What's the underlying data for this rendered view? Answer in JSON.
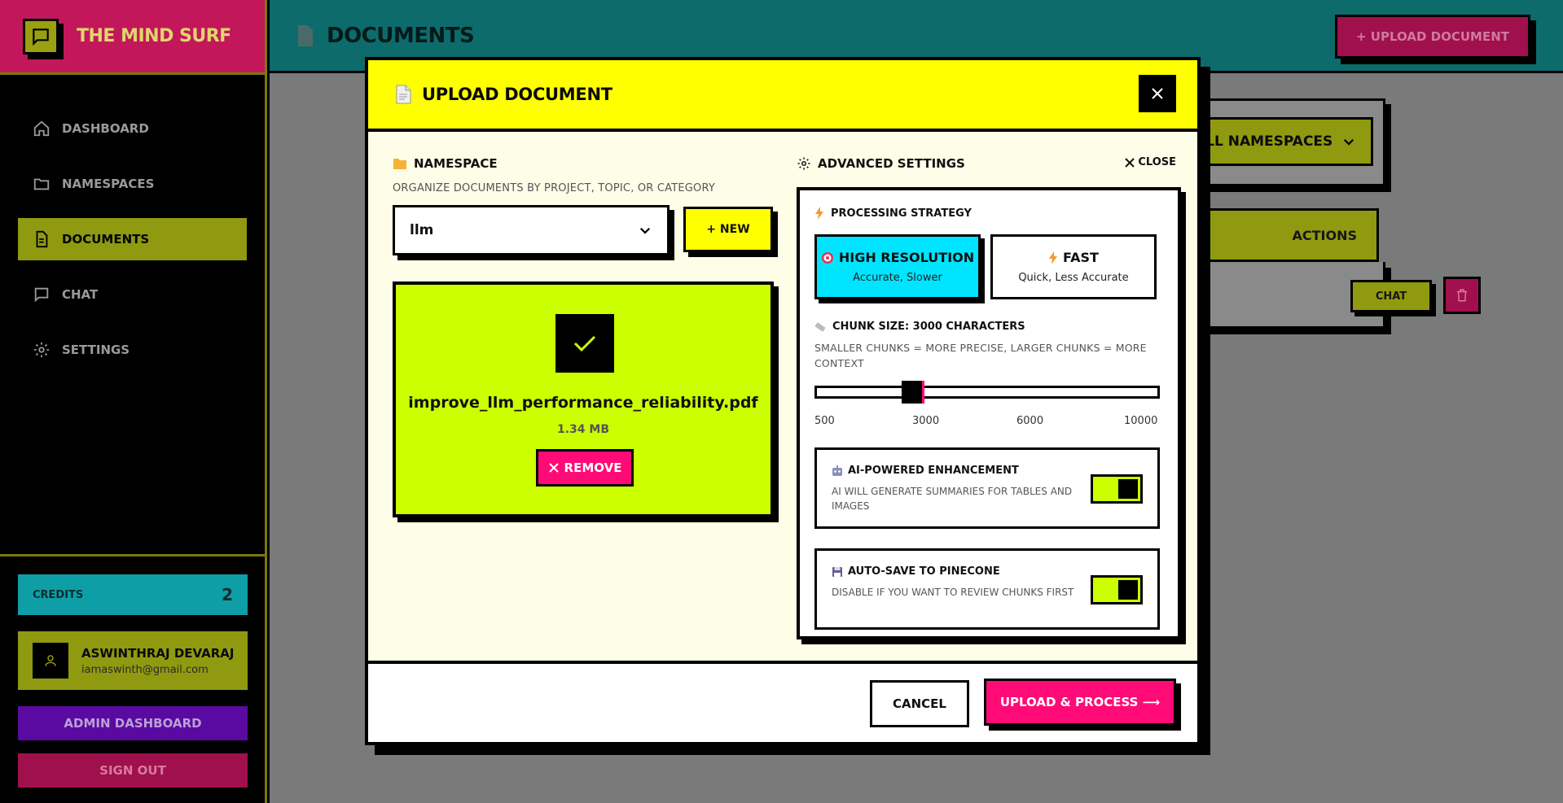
{
  "app": {
    "title": "THE MIND SURF"
  },
  "sidebar": {
    "items": [
      {
        "label": "DASHBOARD",
        "icon": "home-icon"
      },
      {
        "label": "NAMESPACES",
        "icon": "folder-icon"
      },
      {
        "label": "DOCUMENTS",
        "icon": "file-icon",
        "active": true
      },
      {
        "label": "CHAT",
        "icon": "chat-icon"
      },
      {
        "label": "SETTINGS",
        "icon": "gear-icon"
      }
    ],
    "credits": {
      "label": "CREDITS",
      "value": "2"
    },
    "user": {
      "name": "ASWINTHRAJ DEVARAJ",
      "email": "iamaswinth@gmail.com"
    },
    "admin_label": "ADMIN DASHBOARD",
    "signout_label": "SIGN OUT"
  },
  "page": {
    "title": "DOCUMENTS",
    "upload_label": "+ UPLOAD DOCUMENT",
    "namespace_filter": "ALL NAMESPACES",
    "actions_header": "ACTIONS",
    "row_chat_label": "CHAT"
  },
  "modal": {
    "title": "UPLOAD DOCUMENT",
    "namespace": {
      "title": "NAMESPACE",
      "help": "ORGANIZE DOCUMENTS BY PROJECT, TOPIC, OR CATEGORY",
      "selected": "llm",
      "new_label": "+ NEW"
    },
    "file": {
      "name": "improve_llm_performance_reliability.pdf",
      "size": "1.34 MB",
      "remove_label": "REMOVE"
    },
    "advanced": {
      "title": "ADVANCED SETTINGS",
      "close_label": "CLOSE",
      "strategy_title": "PROCESSING STRATEGY",
      "strategies": [
        {
          "title": "HIGH RESOLUTION",
          "desc": "Accurate, Slower",
          "selected": true
        },
        {
          "title": "FAST",
          "desc": "Quick, Less Accurate",
          "selected": false
        }
      ],
      "chunk": {
        "title": "CHUNK SIZE: 3000 CHARACTERS",
        "help": "SMALLER CHUNKS = MORE PRECISE, LARGER CHUNKS = MORE CONTEXT",
        "value": 3000,
        "ticks": [
          "500",
          "3000",
          "6000",
          "10000"
        ]
      },
      "toggles": [
        {
          "title": "AI-POWERED ENHANCEMENT",
          "desc": "AI WILL GENERATE SUMMARIES FOR TABLES AND IMAGES",
          "on": true
        },
        {
          "title": "AUTO-SAVE TO PINECONE",
          "desc": "DISABLE IF YOU WANT TO REVIEW CHUNKS FIRST",
          "on": true
        }
      ]
    },
    "cancel_label": "CANCEL",
    "submit_label": "UPLOAD & PROCESS ⟶"
  },
  "colors": {
    "accent_yellow": "#ffff00",
    "accent_lime": "#ccff00",
    "accent_pink": "#ff0a77",
    "accent_cyan": "#00e5ff",
    "teal": "#0d6b6b"
  }
}
